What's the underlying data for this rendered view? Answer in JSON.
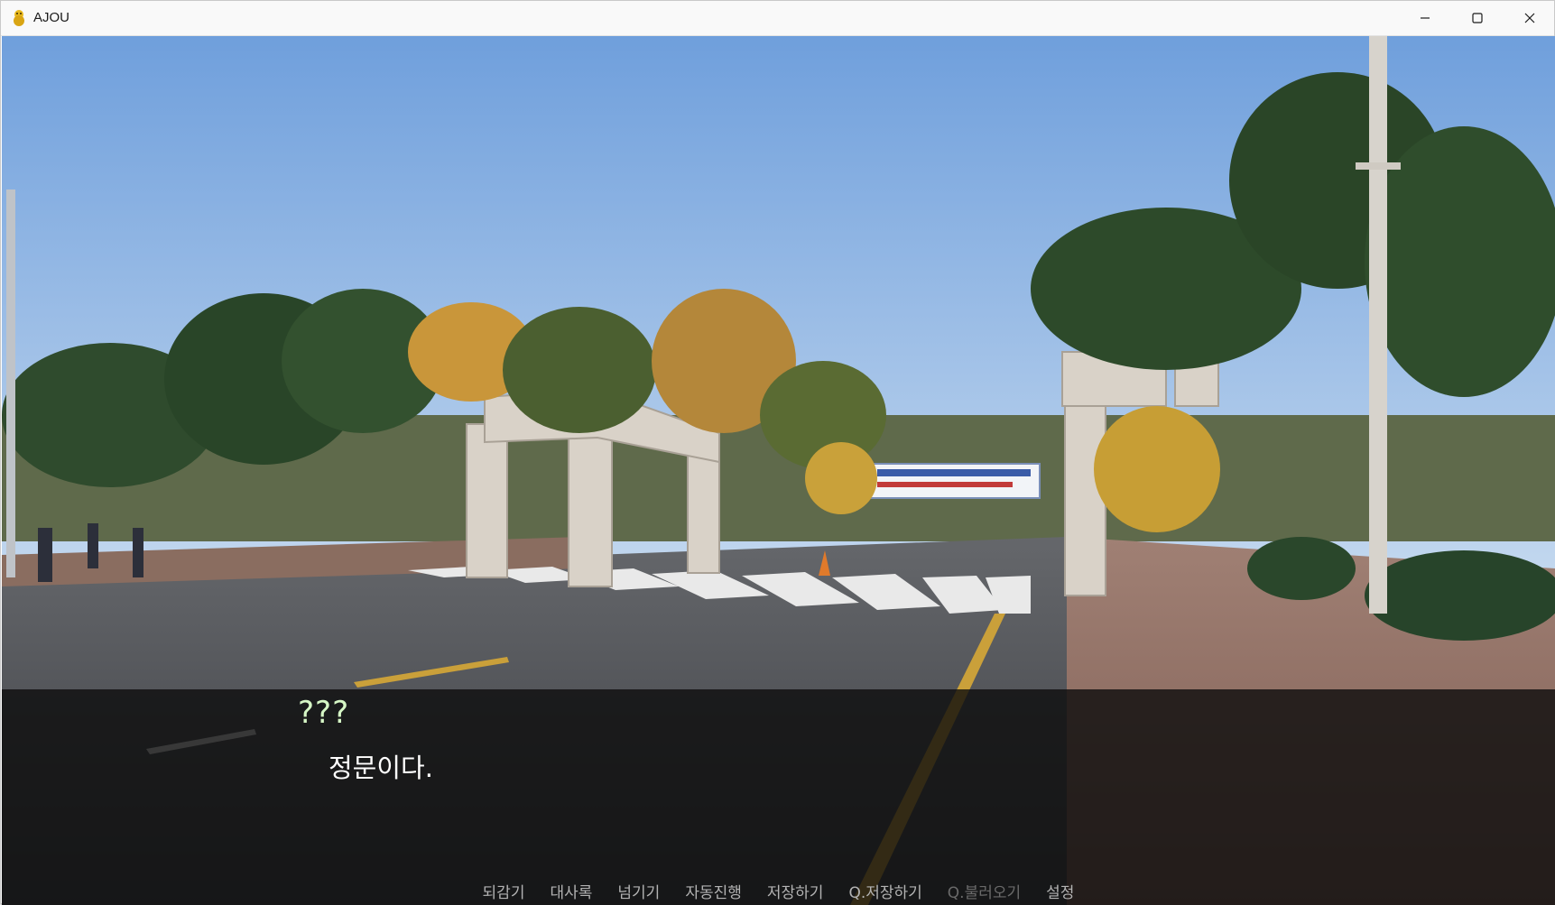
{
  "window": {
    "title": "AJOU",
    "icon": "ajou-mascot-icon",
    "controls": {
      "minimize": "minimize-icon",
      "maximize": "maximize-icon",
      "close": "close-icon"
    }
  },
  "scene": {
    "description_icon": "campus-main-gate-background",
    "colors": {
      "sky_top": "#6f9fdc",
      "sky_bottom": "#bcd4ee",
      "road": "#4a4c52",
      "sidewalk": "#8d6a5e",
      "gate_stone": "#d9d2c8",
      "tree_dark": "#2d4a2a",
      "tree_autumn": "#c9963a"
    }
  },
  "dialogue": {
    "speaker": "???",
    "text": "정문이다.",
    "speaker_color": "#d6f7c6",
    "text_color": "#ffffff"
  },
  "quick_menu": {
    "items": [
      {
        "label": "되감기",
        "enabled": true
      },
      {
        "label": "대사록",
        "enabled": true
      },
      {
        "label": "넘기기",
        "enabled": true
      },
      {
        "label": "자동진행",
        "enabled": true
      },
      {
        "label": "저장하기",
        "enabled": true
      },
      {
        "label": "Q.저장하기",
        "enabled": true
      },
      {
        "label": "Q.불러오기",
        "enabled": false
      },
      {
        "label": "설정",
        "enabled": true
      }
    ]
  }
}
